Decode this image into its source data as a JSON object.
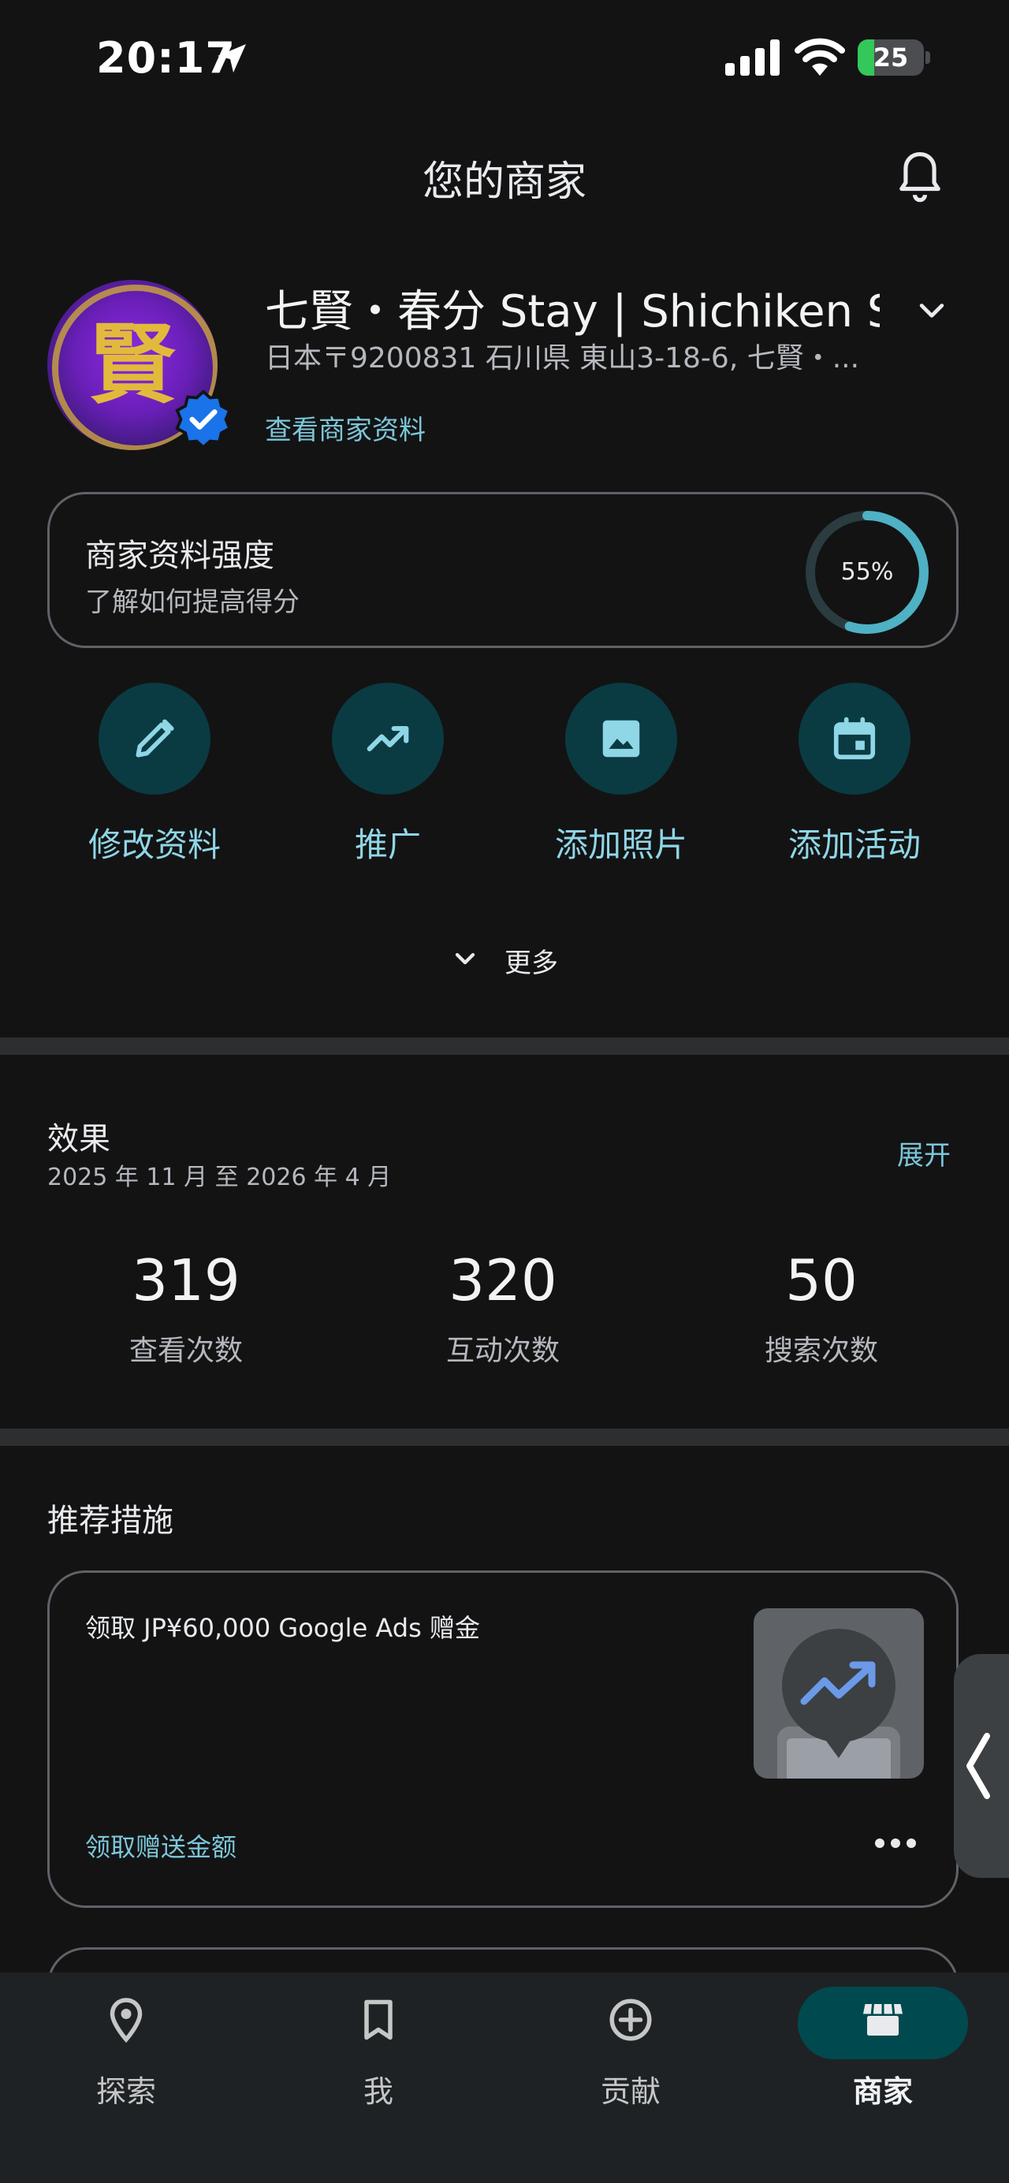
{
  "status_bar": {
    "time": "20:17",
    "battery": "25",
    "battery_level": 0.25,
    "icons": [
      "location-arrow-icon",
      "signal-icon",
      "wifi-icon",
      "battery-charging-icon"
    ]
  },
  "header": {
    "title": "您的商家",
    "bell_icon": "bell-icon"
  },
  "business": {
    "name": "七賢・春分 Stay | Shichiken Sh...",
    "address": "日本〒9200831 石川県 東山3-18-6, 七賢・...",
    "view_profile": "查看商家资料",
    "avatar_text": "賢"
  },
  "strength": {
    "title": "商家资料强度",
    "subtitle": "了解如何提高得分",
    "percent_label": "55%",
    "percent": 55
  },
  "actions": [
    {
      "label": "修改资料",
      "icon": "pencil-icon"
    },
    {
      "label": "推广",
      "icon": "trending-up-icon"
    },
    {
      "label": "添加照片",
      "icon": "image-icon"
    },
    {
      "label": "添加活动",
      "icon": "calendar-icon"
    }
  ],
  "more": {
    "label": "更多"
  },
  "performance": {
    "title": "效果",
    "range": "2025 年 11 月 至 2026 年 4 月",
    "expand": "展开",
    "stats": [
      {
        "value": "319",
        "label": "查看次数"
      },
      {
        "value": "320",
        "label": "互动次数"
      },
      {
        "value": "50",
        "label": "搜索次数"
      }
    ]
  },
  "recommendations": {
    "title": "推荐措施",
    "card": {
      "text": "领取 JP¥60,000 Google Ads 赠金",
      "link": "领取赠送金额"
    }
  },
  "bottom_nav": [
    {
      "label": "探索",
      "icon": "location-pin-icon",
      "active": false
    },
    {
      "label": "我",
      "icon": "bookmark-icon",
      "active": false
    },
    {
      "label": "贡献",
      "icon": "add-circle-icon",
      "active": false
    },
    {
      "label": "商家",
      "icon": "storefront-icon",
      "active": true
    }
  ],
  "colors": {
    "background": "#131314",
    "accent": "#7cc6d8",
    "action_circle": "#0a3b42",
    "ring": "#4fb1c4"
  }
}
